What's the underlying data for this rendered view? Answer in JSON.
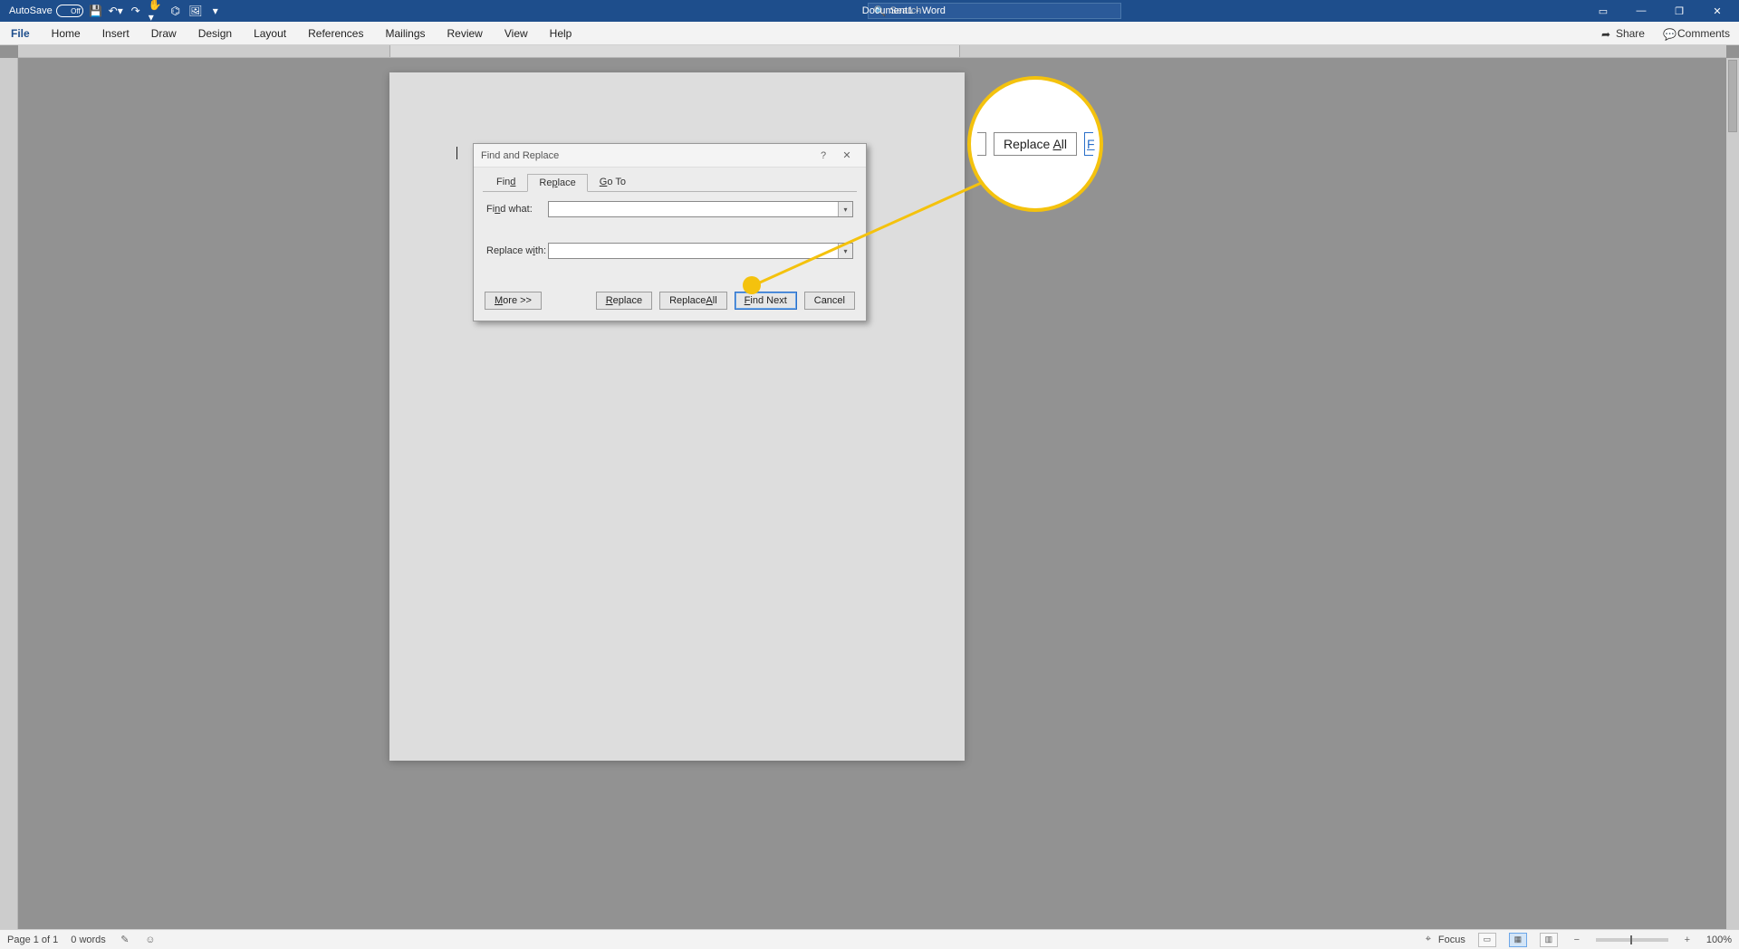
{
  "titlebar": {
    "autosave_label": "AutoSave",
    "autosave_state": "Off",
    "doc_title": "Document1  -  Word",
    "search_placeholder": "Search"
  },
  "ribbon": {
    "tabs": [
      "File",
      "Home",
      "Insert",
      "Draw",
      "Design",
      "Layout",
      "References",
      "Mailings",
      "Review",
      "View",
      "Help"
    ],
    "share_label": "Share",
    "comments_label": "Comments"
  },
  "dialog": {
    "title": "Find and Replace",
    "tabs": {
      "find": "Find",
      "replace": "Replace",
      "goto": "Go To"
    },
    "active_tab": "replace",
    "find_label": "Find what:",
    "find_value": "",
    "replace_label": "Replace with:",
    "replace_value": "",
    "buttons": {
      "more": "More >>",
      "replace": "Replace",
      "replace_all": "Replace All",
      "find_next": "Find Next",
      "cancel": "Cancel"
    }
  },
  "callout": {
    "button_label": "Replace All"
  },
  "statusbar": {
    "page": "Page 1 of 1",
    "words": "0 words",
    "focus": "Focus",
    "zoom": "100%"
  }
}
